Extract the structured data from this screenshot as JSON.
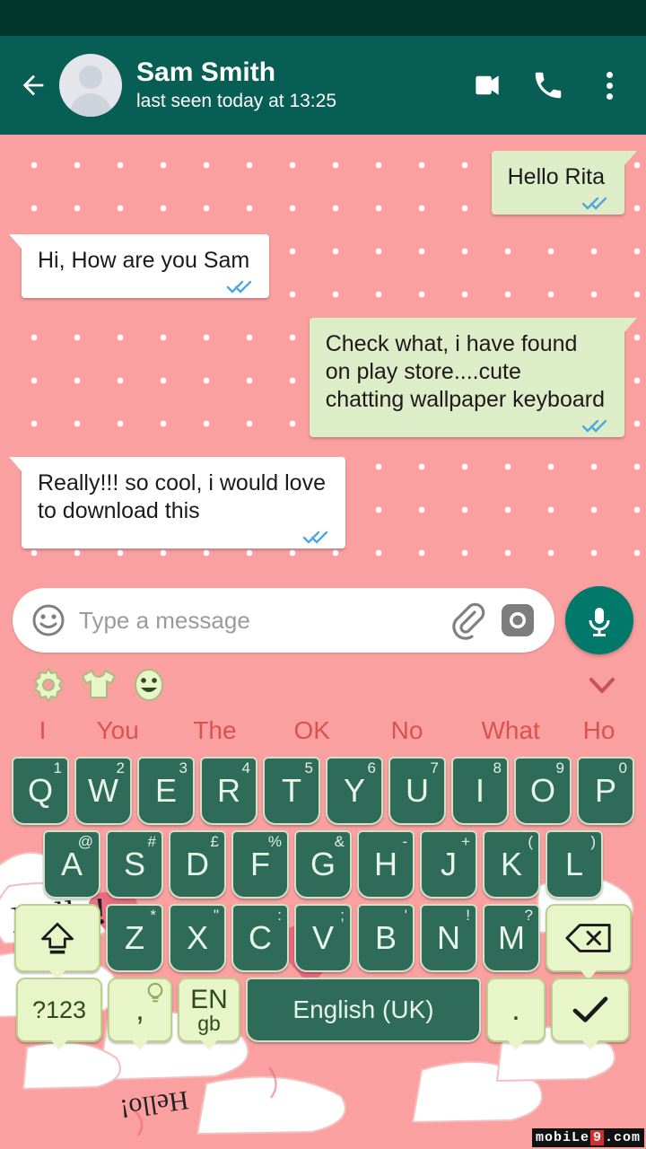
{
  "header": {
    "name": "Sam Smith",
    "status": "last seen today at 13:25",
    "back_icon": "back-arrow-icon",
    "video_icon": "video-call-icon",
    "call_icon": "phone-call-icon",
    "menu_icon": "overflow-menu-icon",
    "bg_color": "#075E54",
    "statusbar_color": "#00362B"
  },
  "chat": {
    "background_color": "#FAA0A0",
    "dot_color": "#FFFFFF",
    "out_bubble_color": "#DCEDC8",
    "in_bubble_color": "#FFFFFF",
    "tick_color": "#4FA8E0",
    "messages": [
      {
        "text": "Hello Rita",
        "side": "out",
        "ticks": "double-check-read"
      },
      {
        "text": "Hi, How are you Sam",
        "side": "in",
        "ticks": "double-check-read"
      },
      {
        "text": "Check what, i have found\non play store....cute\nchatting wallpaper keyboard",
        "side": "out",
        "ticks": "double-check-read"
      },
      {
        "text": "Really!!! so cool, i would love\nto download this",
        "side": "in",
        "ticks": "double-check-read"
      }
    ]
  },
  "input_bar": {
    "placeholder": "Type a message",
    "emoji_icon": "smiley-face-icon",
    "attach_icon": "paperclip-icon",
    "camera_icon": "camera-icon",
    "mic_icon": "microphone-icon",
    "mic_button_color": "#00796B"
  },
  "keyboard": {
    "toolbar": [
      {
        "icon": "gear-icon",
        "name": "keyboard-settings"
      },
      {
        "icon": "tshirt-icon",
        "name": "keyboard-theme"
      },
      {
        "icon": "emoji-icon",
        "name": "keyboard-emoji"
      }
    ],
    "collapse_icon": "chevron-down-icon",
    "suggestions": [
      "I",
      "You",
      "The",
      "OK",
      "No",
      "What",
      "Ho"
    ],
    "suggestion_color": "#D9534F",
    "key_color": "#2E6B58",
    "key_text_color": "#E8F5E9",
    "special_key_color": "#E8F5C8",
    "row1": [
      {
        "label": "Q",
        "hint": "1"
      },
      {
        "label": "W",
        "hint": "2"
      },
      {
        "label": "E",
        "hint": "3"
      },
      {
        "label": "R",
        "hint": "4"
      },
      {
        "label": "T",
        "hint": "5"
      },
      {
        "label": "Y",
        "hint": "6"
      },
      {
        "label": "U",
        "hint": "7"
      },
      {
        "label": "I",
        "hint": "8"
      },
      {
        "label": "O",
        "hint": "9"
      },
      {
        "label": "P",
        "hint": "0"
      }
    ],
    "row2": [
      {
        "label": "A",
        "hint": "@"
      },
      {
        "label": "S",
        "hint": "#"
      },
      {
        "label": "D",
        "hint": "£"
      },
      {
        "label": "F",
        "hint": "%"
      },
      {
        "label": "G",
        "hint": "&"
      },
      {
        "label": "H",
        "hint": "-"
      },
      {
        "label": "J",
        "hint": "+"
      },
      {
        "label": "K",
        "hint": "("
      },
      {
        "label": "L",
        "hint": ")"
      }
    ],
    "row3": [
      {
        "label": "Z",
        "hint": "*"
      },
      {
        "label": "X",
        "hint": "\""
      },
      {
        "label": "C",
        "hint": ":"
      },
      {
        "label": "V",
        "hint": ";"
      },
      {
        "label": "B",
        "hint": "'"
      },
      {
        "label": "N",
        "hint": "!"
      },
      {
        "label": "M",
        "hint": "?"
      }
    ],
    "shift_icon": "shift-up-arrow-icon",
    "backspace_icon": "backspace-icon",
    "symbols_label": "?123",
    "comma_label": ",",
    "comma_hint_icon": "lightbulb-icon",
    "lang_line1": "EN",
    "lang_line2": "gb",
    "space_label": "English (UK)",
    "period_label": ".",
    "enter_icon": "checkmark-icon"
  },
  "watermark": {
    "part1": "mobiLe",
    "part2": "9",
    "part3": ".com"
  }
}
